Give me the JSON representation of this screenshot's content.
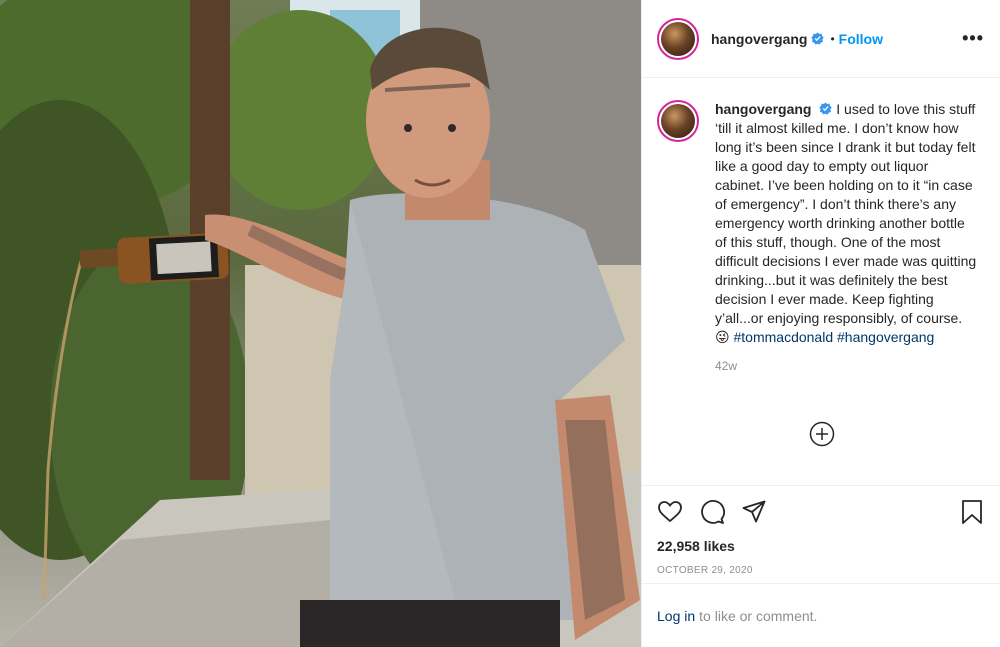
{
  "header": {
    "username": "hangovergang",
    "dot": "•",
    "follow_label": "Follow",
    "more_label": "•••"
  },
  "caption": {
    "username": "hangovergang",
    "text": "I used to love this stuff ‘till it almost killed me. I don’t know how long it’s been since I drank it but today felt like a good day to empty out liquor cabinet. I’ve been holding on to it “in case of emergency”. I don’t think there’s any emergency worth drinking another bottle of this stuff, though. One of the most difficult decisions I ever made was quitting drinking...but it was definitely the best decision I ever made. Keep fighting y’all...or enjoying responsibly, of course.",
    "emoji": "😜",
    "hashtags": [
      "#tommacdonald",
      "#hangovergang"
    ],
    "age": "42w"
  },
  "engagement": {
    "likes": "22,958 likes",
    "date": "OCTOBER 29, 2020"
  },
  "comment_bar": {
    "login_label": "Log in",
    "prompt": "to like or comment."
  },
  "colors": {
    "accent": "#0095f6",
    "hashtag": "#00376b",
    "muted": "#8e8e8e",
    "story_ring": "#d6249f"
  }
}
